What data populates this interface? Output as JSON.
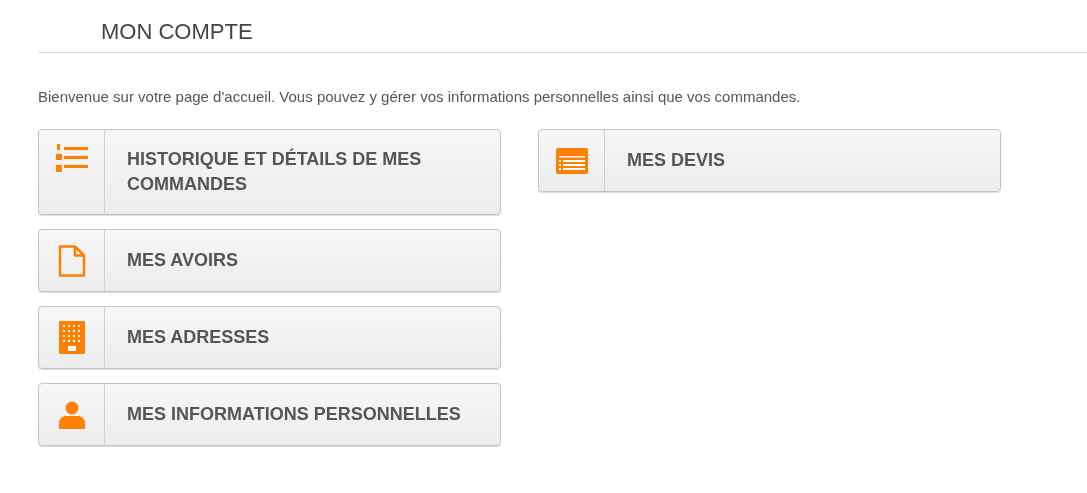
{
  "page": {
    "title": "MON COMPTE",
    "intro": "Bienvenue sur votre page d'accueil. Vous pouvez y gérer vos informations personnelles ainsi que vos commandes."
  },
  "columns": [
    {
      "items": [
        {
          "kind": "list",
          "label": "HISTORIQUE ET DÉTAILS DE MES COMMANDES"
        },
        {
          "kind": "document",
          "label": "MES AVOIRS"
        },
        {
          "kind": "building",
          "label": "MES ADRESSES"
        },
        {
          "kind": "person",
          "label": "MES INFORMATIONS PERSONNELLES"
        }
      ]
    },
    {
      "items": [
        {
          "kind": "quote",
          "label": "MES DEVIS"
        }
      ]
    }
  ]
}
